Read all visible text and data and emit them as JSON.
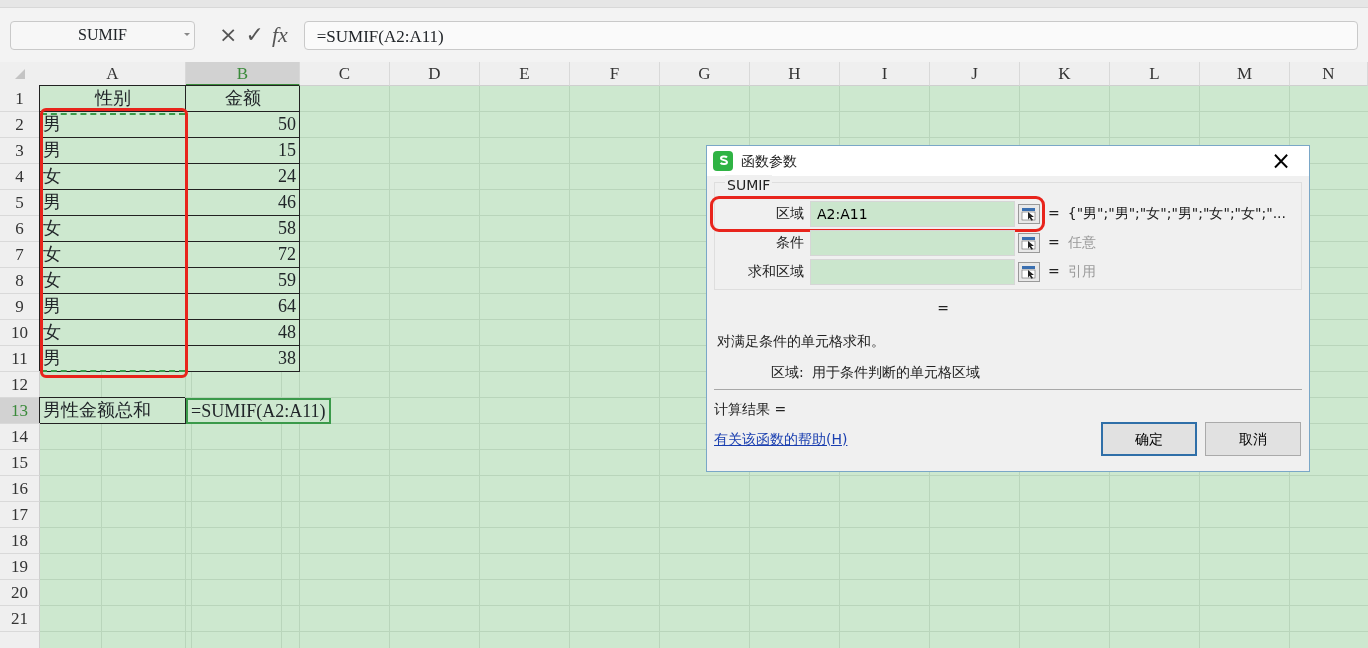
{
  "formula_bar": {
    "name_box": "SUMIF",
    "cancel": "×",
    "enter": "✓",
    "fx": "fx",
    "formula": "=SUMIF(A2:A11)"
  },
  "sheet": {
    "columns": [
      {
        "label": "A",
        "selected": false
      },
      {
        "label": "B",
        "selected": true
      },
      {
        "label": "C",
        "selected": false
      },
      {
        "label": "D",
        "selected": false
      },
      {
        "label": "E",
        "selected": false
      },
      {
        "label": "F",
        "selected": false
      },
      {
        "label": "G",
        "selected": false
      },
      {
        "label": "H",
        "selected": false
      },
      {
        "label": "I",
        "selected": false
      },
      {
        "label": "J",
        "selected": false
      },
      {
        "label": "K",
        "selected": false
      },
      {
        "label": "L",
        "selected": false
      },
      {
        "label": "M",
        "selected": false
      },
      {
        "label": "N",
        "selected": false
      }
    ],
    "rows": [
      {
        "label": "1",
        "selected": false,
        "cells": [
          {
            "text": "性别",
            "kind": "header",
            "bordered": true,
            "marked": false,
            "selected": false
          },
          {
            "text": "金额",
            "kind": "header",
            "bordered": true,
            "marked": false,
            "selected": false
          }
        ]
      },
      {
        "label": "2",
        "selected": false,
        "cells": [
          {
            "text": "男",
            "kind": "text",
            "bordered": true,
            "marked": true,
            "selected": false
          },
          {
            "text": "50",
            "kind": "number",
            "bordered": true,
            "marked": false,
            "selected": false
          }
        ]
      },
      {
        "label": "3",
        "selected": false,
        "cells": [
          {
            "text": "男",
            "kind": "text",
            "bordered": true,
            "marked": true,
            "selected": false
          },
          {
            "text": "15",
            "kind": "number",
            "bordered": true,
            "marked": false,
            "selected": false
          }
        ]
      },
      {
        "label": "4",
        "selected": false,
        "cells": [
          {
            "text": "女",
            "kind": "text",
            "bordered": true,
            "marked": true,
            "selected": false
          },
          {
            "text": "24",
            "kind": "number",
            "bordered": true,
            "marked": false,
            "selected": false
          }
        ]
      },
      {
        "label": "5",
        "selected": false,
        "cells": [
          {
            "text": "男",
            "kind": "text",
            "bordered": true,
            "marked": true,
            "selected": false
          },
          {
            "text": "46",
            "kind": "number",
            "bordered": true,
            "marked": false,
            "selected": false
          }
        ]
      },
      {
        "label": "6",
        "selected": false,
        "cells": [
          {
            "text": "女",
            "kind": "text",
            "bordered": true,
            "marked": true,
            "selected": false
          },
          {
            "text": "58",
            "kind": "number",
            "bordered": true,
            "marked": false,
            "selected": false
          }
        ]
      },
      {
        "label": "7",
        "selected": false,
        "cells": [
          {
            "text": "女",
            "kind": "text",
            "bordered": true,
            "marked": true,
            "selected": false
          },
          {
            "text": "72",
            "kind": "number",
            "bordered": true,
            "marked": false,
            "selected": false
          }
        ]
      },
      {
        "label": "8",
        "selected": false,
        "cells": [
          {
            "text": "女",
            "kind": "text",
            "bordered": true,
            "marked": true,
            "selected": false
          },
          {
            "text": "59",
            "kind": "number",
            "bordered": true,
            "marked": false,
            "selected": false
          }
        ]
      },
      {
        "label": "9",
        "selected": false,
        "cells": [
          {
            "text": "男",
            "kind": "text",
            "bordered": true,
            "marked": true,
            "selected": false
          },
          {
            "text": "64",
            "kind": "number",
            "bordered": true,
            "marked": false,
            "selected": false
          }
        ]
      },
      {
        "label": "10",
        "selected": false,
        "cells": [
          {
            "text": "女",
            "kind": "text",
            "bordered": true,
            "marked": true,
            "selected": false
          },
          {
            "text": "48",
            "kind": "number",
            "bordered": true,
            "marked": false,
            "selected": false
          }
        ]
      },
      {
        "label": "11",
        "selected": false,
        "cells": [
          {
            "text": "男",
            "kind": "text",
            "bordered": true,
            "marked": true,
            "selected": false
          },
          {
            "text": "38",
            "kind": "number",
            "bordered": true,
            "marked": false,
            "selected": false
          }
        ]
      },
      {
        "label": "12",
        "selected": false,
        "cells": []
      },
      {
        "label": "13",
        "selected": true,
        "cells": [
          {
            "text": "男性金额总和",
            "kind": "text",
            "bordered": true,
            "marked": false,
            "selected": false
          },
          {
            "text": "=SUMIF(A2:A11)",
            "kind": "formula",
            "bordered": false,
            "marked": false,
            "selected": true
          }
        ]
      },
      {
        "label": "14",
        "selected": false,
        "cells": []
      },
      {
        "label": "15",
        "selected": false,
        "cells": []
      },
      {
        "label": "16",
        "selected": false,
        "cells": []
      },
      {
        "label": "17",
        "selected": false,
        "cells": []
      },
      {
        "label": "18",
        "selected": false,
        "cells": []
      },
      {
        "label": "19",
        "selected": false,
        "cells": []
      },
      {
        "label": "20",
        "selected": false,
        "cells": []
      },
      {
        "label": "21",
        "selected": false,
        "cells": []
      }
    ],
    "marked_range_highlighted": true
  },
  "dialog": {
    "title": "函数参数",
    "close": "×",
    "function_name": "SUMIF",
    "arguments": [
      {
        "label": "区域",
        "value": "A2:A11",
        "equals": "=",
        "result": "{\"男\";\"男\";\"女\";\"男\";\"女\";\"女\";\"...",
        "greyed": false,
        "highlighted": true
      },
      {
        "label": "条件",
        "equals": "=",
        "result": "任意",
        "greyed": true,
        "highlighted": false
      },
      {
        "label": "求和区域",
        "equals": "=",
        "result": "引用",
        "greyed": true,
        "highlighted": false
      }
    ],
    "function_result": "=",
    "description": "对满足条件的单元格求和。",
    "arg_help_label": "区域:",
    "arg_help": "用于条件判断的单元格区域",
    "calc_result": "计算结果 =",
    "help_link": "有关该函数的帮助(H)",
    "buttons": [
      {
        "label": "确定",
        "default": true
      },
      {
        "label": "取消",
        "default": false
      }
    ]
  }
}
